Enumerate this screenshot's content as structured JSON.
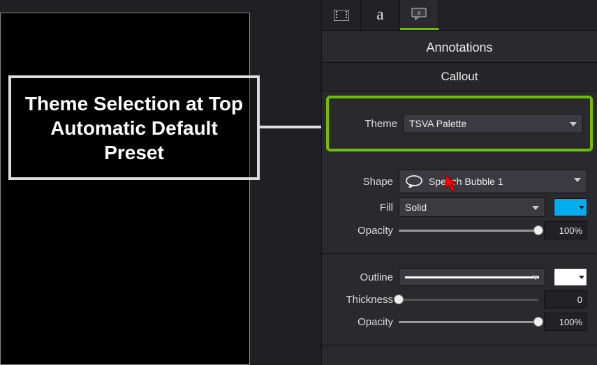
{
  "canvas": {
    "callout_text": "Theme Selection at Top Automatic Default Preset"
  },
  "panel": {
    "title": "Annotations",
    "subtitle": "Callout",
    "theme": {
      "label": "Theme",
      "value": "TSVA Palette"
    },
    "shape": {
      "label": "Shape",
      "value": "Speech Bubble 1"
    },
    "fill": {
      "label": "Fill",
      "value": "Solid",
      "color": "#00aeef"
    },
    "fill_opacity": {
      "label": "Opacity",
      "value": "100%",
      "percent": 100
    },
    "outline": {
      "label": "Outline",
      "color": "#ffffff"
    },
    "thickness": {
      "label": "Thickness",
      "value": "0",
      "percent": 0
    },
    "outline_opacity": {
      "label": "Opacity",
      "value": "100%",
      "percent": 100
    }
  }
}
